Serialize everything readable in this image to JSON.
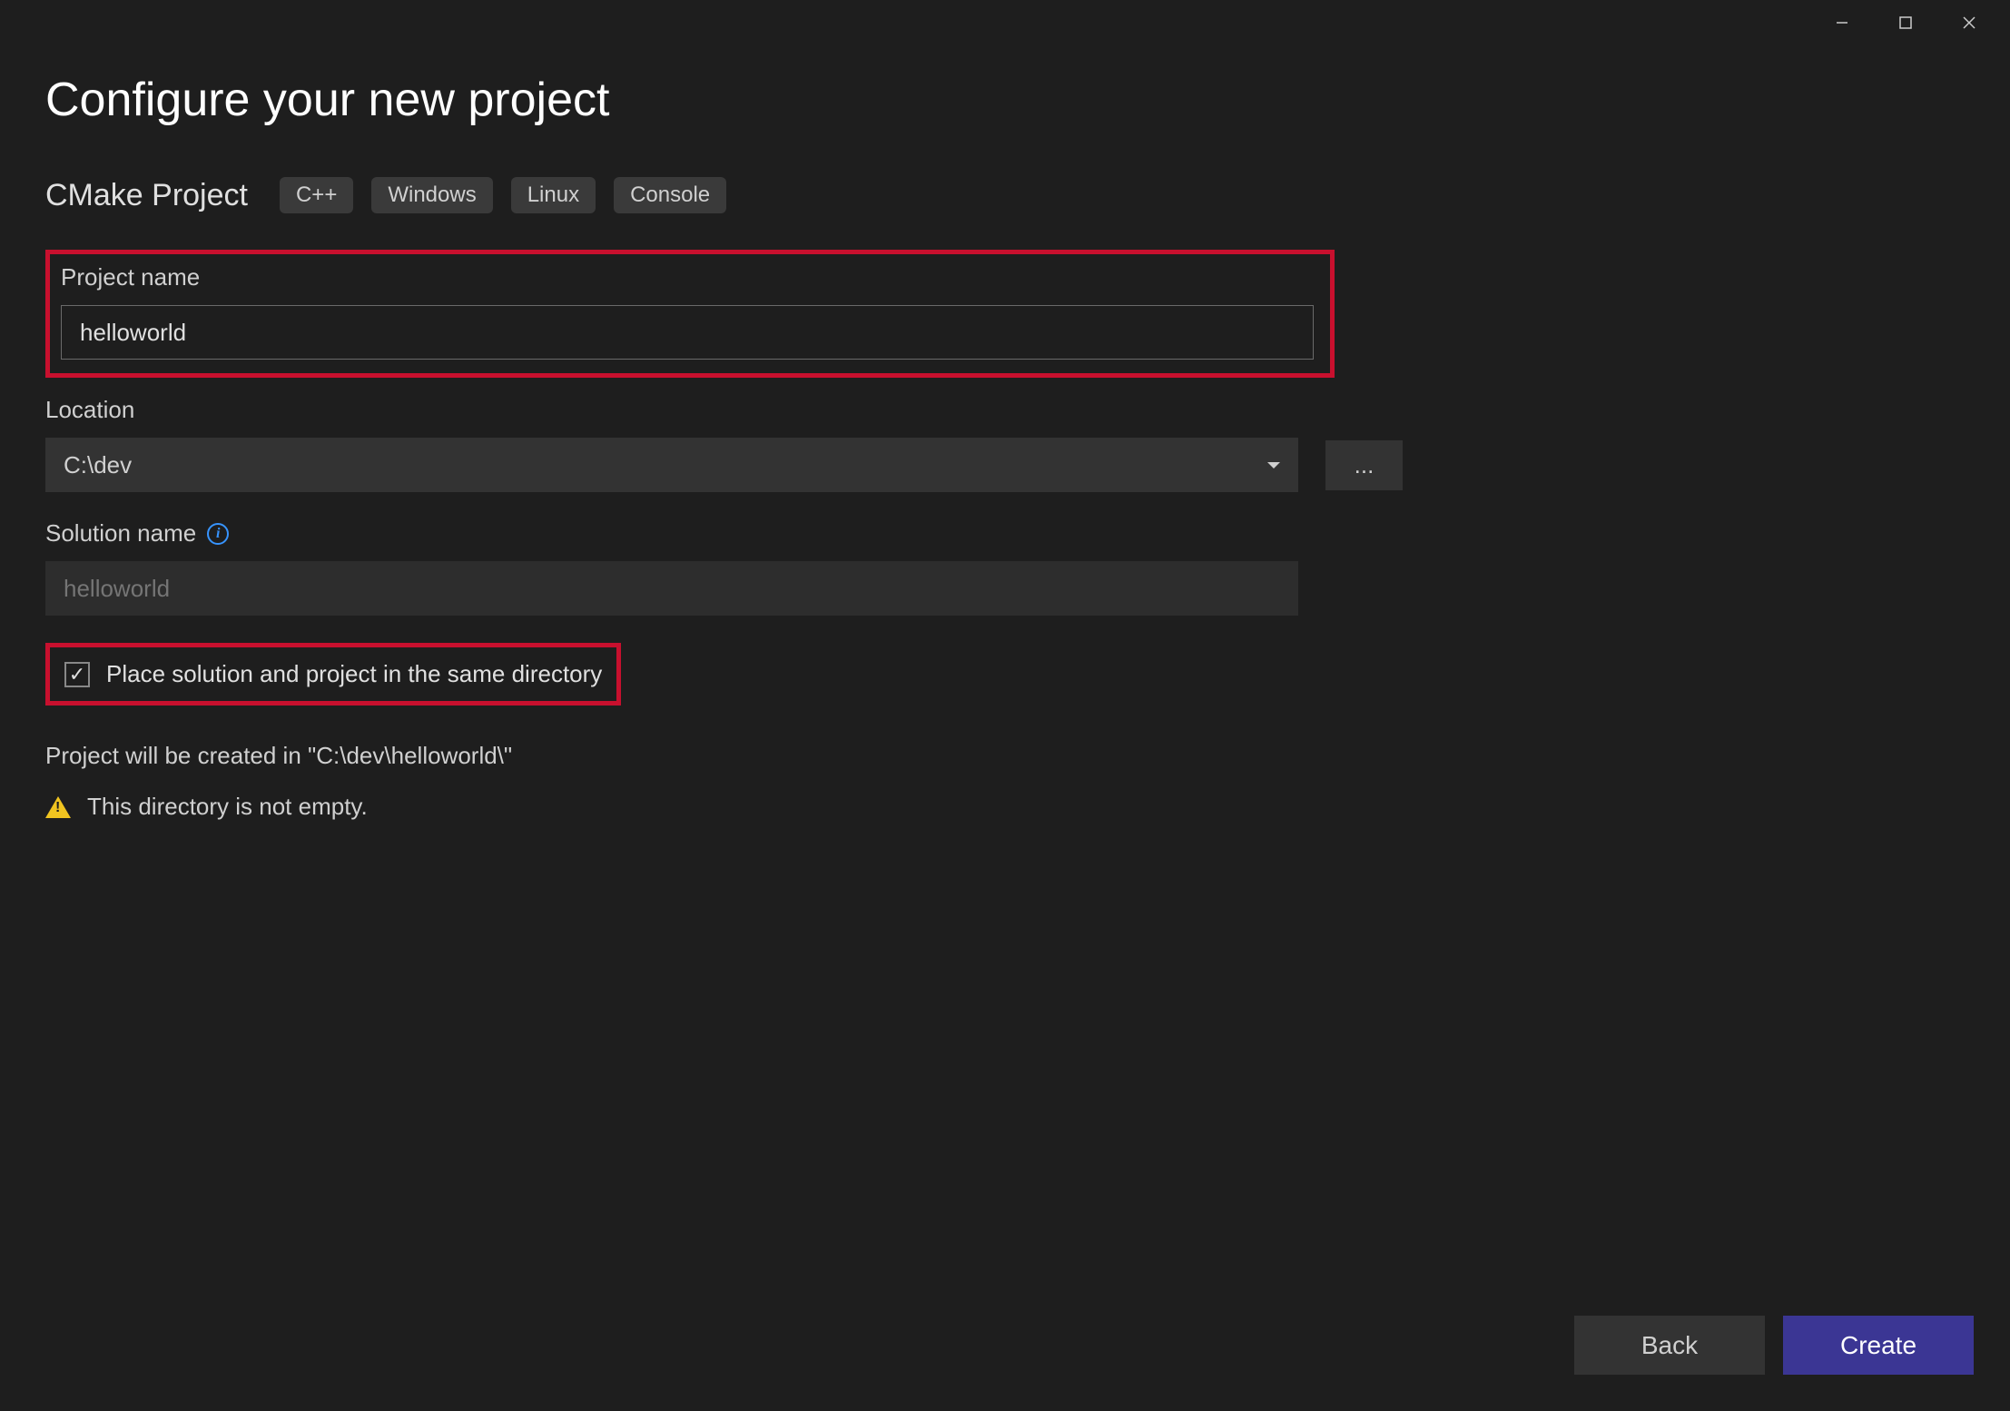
{
  "titlebar": {
    "minimize": "—",
    "maximize": "□",
    "close": "✕"
  },
  "page": {
    "title": "Configure your new project"
  },
  "project": {
    "type_name": "CMake Project",
    "tags": [
      "C++",
      "Windows",
      "Linux",
      "Console"
    ]
  },
  "fields": {
    "project_name": {
      "label": "Project name",
      "value": "helloworld"
    },
    "location": {
      "label": "Location",
      "value": "C:\\dev",
      "browse": "..."
    },
    "solution_name": {
      "label": "Solution name",
      "placeholder": "helloworld"
    },
    "same_directory": {
      "label": "Place solution and project in the same directory",
      "checked": true
    }
  },
  "status": {
    "creation_path": "Project will be created in \"C:\\dev\\helloworld\\\"",
    "warning": "This directory is not empty."
  },
  "footer": {
    "back": "Back",
    "create": "Create"
  }
}
